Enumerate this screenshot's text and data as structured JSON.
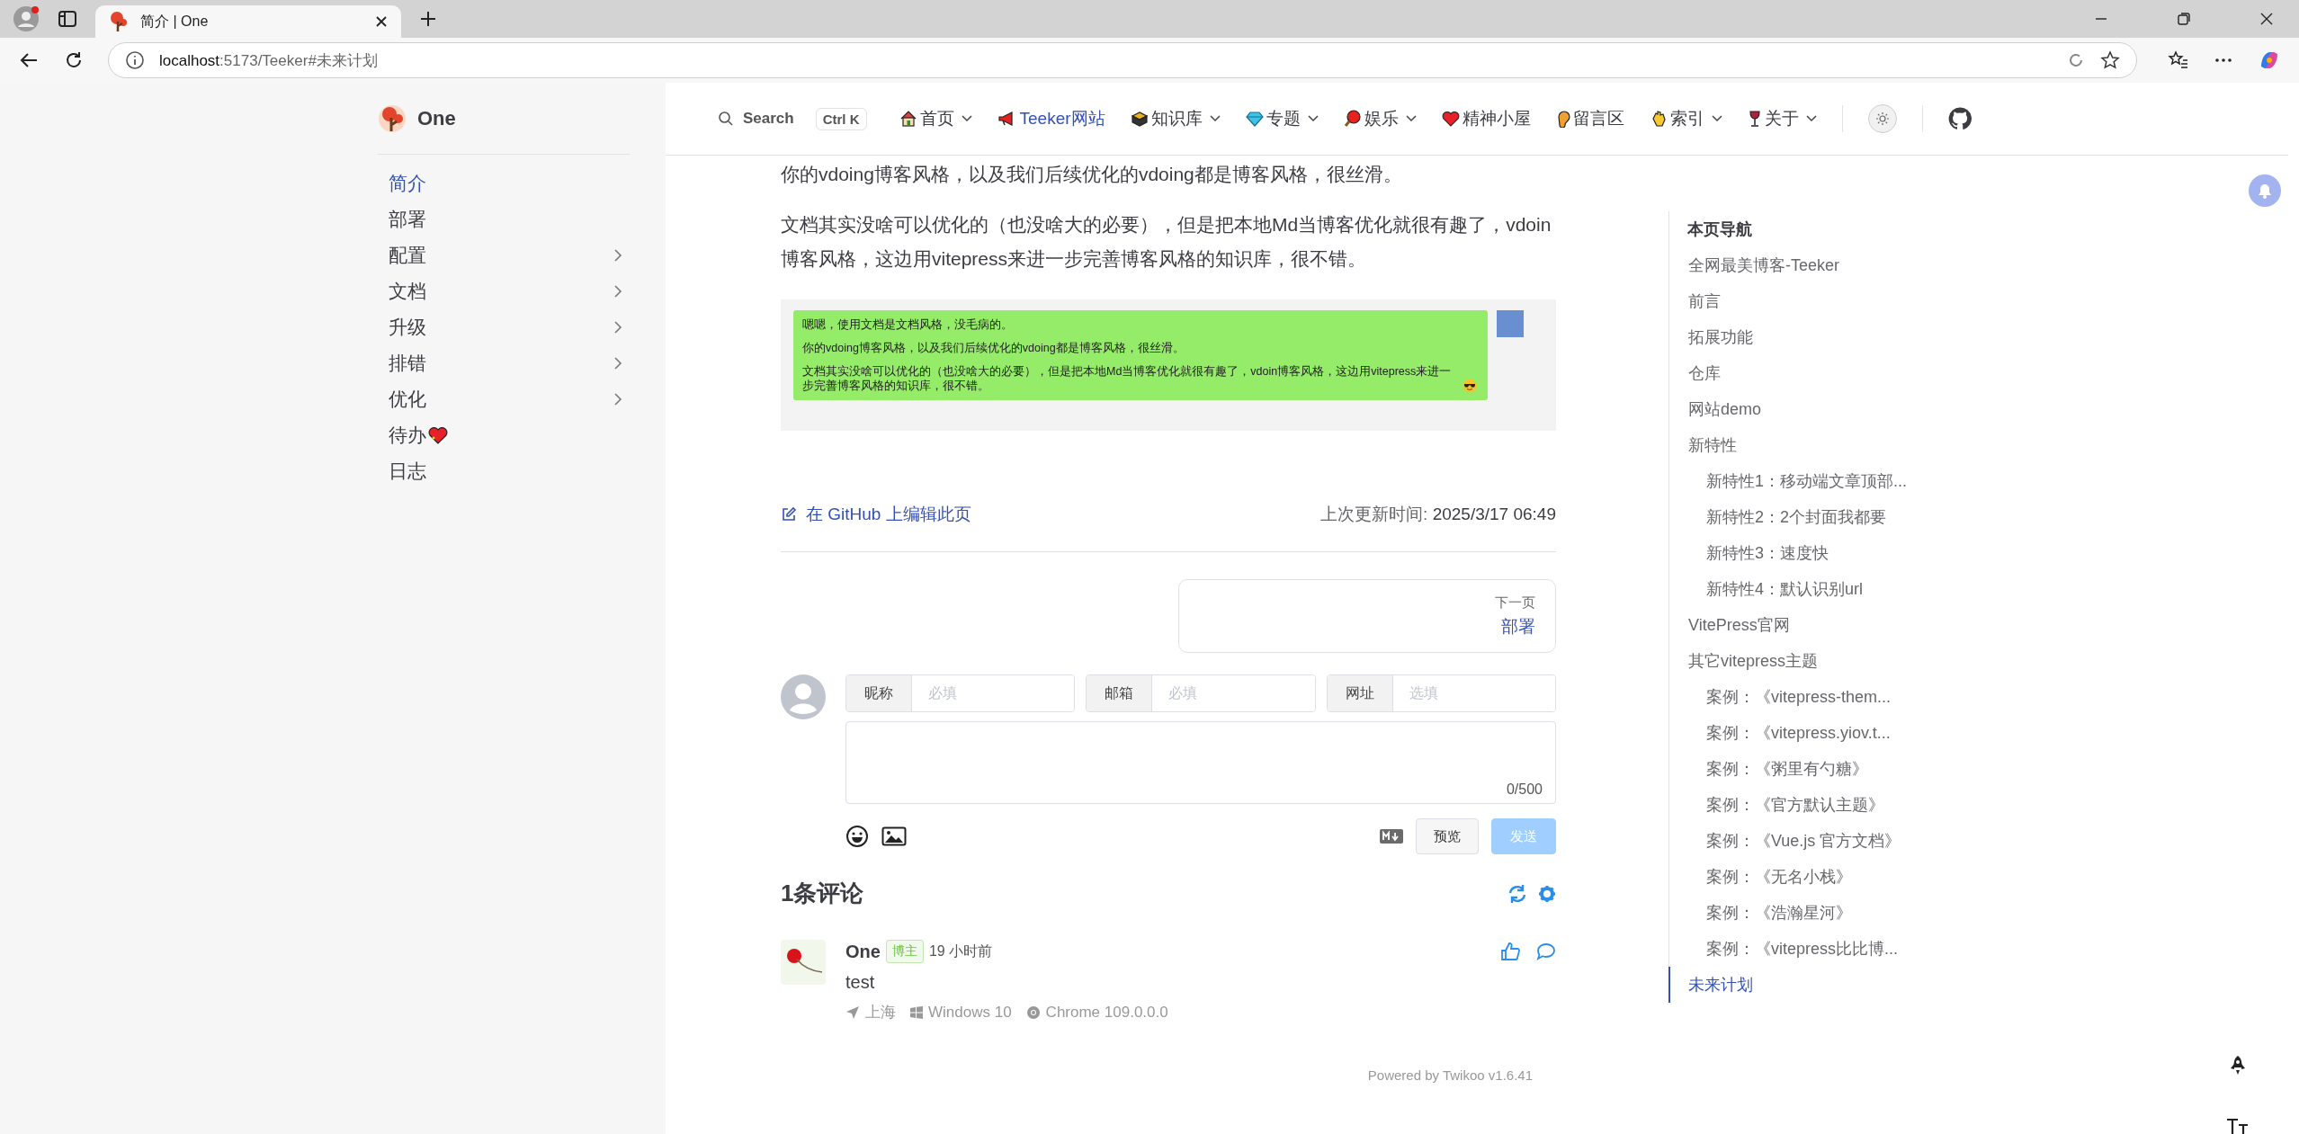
{
  "browser": {
    "tab_title": "简介 | One",
    "url_host": "localhost",
    "url_rest": ":5173/Teeker#未来计划"
  },
  "site": {
    "title": "One"
  },
  "sidebar": {
    "items": [
      {
        "label": "简介",
        "selected": true,
        "expandable": false
      },
      {
        "label": "部署",
        "selected": false,
        "expandable": false
      },
      {
        "label": "配置",
        "selected": false,
        "expandable": true
      },
      {
        "label": "文档",
        "selected": false,
        "expandable": true
      },
      {
        "label": "升级",
        "selected": false,
        "expandable": true
      },
      {
        "label": "排错",
        "selected": false,
        "expandable": true
      },
      {
        "label": "优化",
        "selected": false,
        "expandable": true
      },
      {
        "label": "待办",
        "selected": false,
        "expandable": false
      },
      {
        "label": "日志",
        "selected": false,
        "expandable": false
      }
    ]
  },
  "navbar": {
    "search": {
      "placeholder": "Search",
      "shortcut": "Ctrl K"
    },
    "items": [
      {
        "label": "首页",
        "dropdown": true,
        "selected": false
      },
      {
        "label": "Teeker网站",
        "dropdown": false,
        "selected": true
      },
      {
        "label": "知识库",
        "dropdown": true,
        "selected": false
      },
      {
        "label": "专题",
        "dropdown": true,
        "selected": false
      },
      {
        "label": "娱乐",
        "dropdown": true,
        "selected": false
      },
      {
        "label": "精神小屋",
        "dropdown": false,
        "selected": false
      },
      {
        "label": "留言区",
        "dropdown": false,
        "selected": false
      },
      {
        "label": "索引",
        "dropdown": true,
        "selected": false
      },
      {
        "label": "关于",
        "dropdown": true,
        "selected": false
      }
    ]
  },
  "article": {
    "paragraphs": [
      "你的vdoing博客风格，以及我们后续优化的vdoing都是博客风格，很丝滑。",
      "文档其实没啥可以优化的（也没啥大的必要），但是把本地Md当博客优化就很有趣了，vdoin博客风格，这边用vitepress来进一步完善博客风格的知识库，很不错。"
    ],
    "screenshot": {
      "messages": [
        "嗯嗯，使用文档是文档风格，没毛病的。",
        "你的vdoing博客风格，以及我们后续优化的vdoing都是博客风格，很丝滑。",
        "文档其实没啥可以优化的（也没啥大的必要），但是把本地Md当博客优化就很有趣了，vdoin博客风格，这边用vitepress来进一步完善博客风格的知识库，很不错。"
      ]
    },
    "edit_link": "在 GitHub 上编辑此页",
    "last_updated": {
      "label": "上次更新时间:",
      "value": "2025/3/17 06:49"
    },
    "next_page": {
      "label": "下一页",
      "title": "部署"
    }
  },
  "comments": {
    "form": {
      "fields": [
        {
          "label": "昵称",
          "placeholder": "必填"
        },
        {
          "label": "邮箱",
          "placeholder": "必填"
        },
        {
          "label": "网址",
          "placeholder": "选填"
        }
      ],
      "counter": "0/500",
      "preview_button": "预览",
      "send_button": "发送",
      "send_disabled": true
    },
    "count_title": "1条评论",
    "items": [
      {
        "author": "One",
        "badge": "博主",
        "time": "19 小时前",
        "text": "test",
        "location": "上海",
        "os": "Windows 10",
        "browser": "Chrome 109.0.0.0"
      }
    ],
    "powered_by": "Powered by Twikoo v1.6.41"
  },
  "toc": {
    "title": "本页导航",
    "items": [
      {
        "label": "全网最美博客-Teeker",
        "selected": false
      },
      {
        "label": "前言",
        "selected": false
      },
      {
        "label": "拓展功能",
        "selected": false
      },
      {
        "label": "仓库",
        "selected": false
      },
      {
        "label": "网站demo",
        "selected": false
      },
      {
        "label": "新特性",
        "selected": false,
        "children": [
          {
            "label": "新特性1：移动端文章顶部...",
            "selected": false
          },
          {
            "label": "新特性2：2个封面我都要",
            "selected": false
          },
          {
            "label": "新特性3：速度快",
            "selected": false
          },
          {
            "label": "新特性4：默认识别url",
            "selected": false
          }
        ]
      },
      {
        "label": "VitePress官网",
        "selected": false
      },
      {
        "label": "其它vitepress主题",
        "selected": false,
        "children": [
          {
            "label": "案例：《vitepress-them...",
            "selected": false
          },
          {
            "label": "案例：《vitepress.yiov.t...",
            "selected": false
          },
          {
            "label": "案例：《粥里有勺糖》",
            "selected": false
          },
          {
            "label": "案例：《官方默认主题》",
            "selected": false
          },
          {
            "label": "案例：《Vue.js 官方文档》",
            "selected": false
          },
          {
            "label": "案例：《无名小栈》",
            "selected": false
          },
          {
            "label": "案例：《浩瀚星河》",
            "selected": false
          },
          {
            "label": "案例：《vitepress比比博...",
            "selected": false
          }
        ]
      },
      {
        "label": "未来计划",
        "selected": true
      }
    ]
  }
}
